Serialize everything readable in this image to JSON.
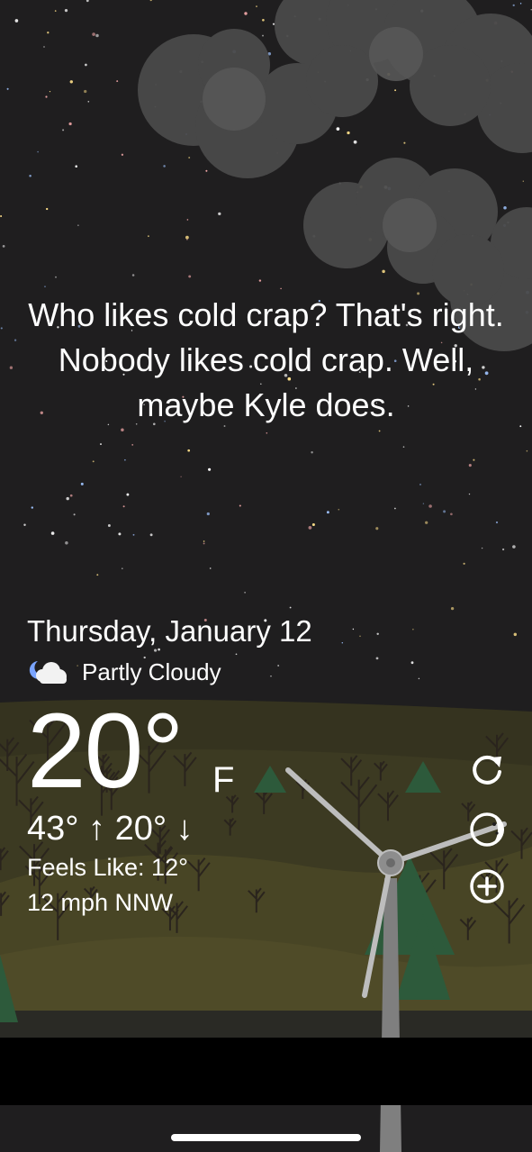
{
  "quote": "Who likes cold crap? That's right. Nobody likes cold crap. Well, maybe Kyle does.",
  "date": "Thursday, January 12",
  "condition": {
    "icon": "partly-cloudy-night-icon",
    "text": "Partly Cloudy"
  },
  "temperature": {
    "value": "20°",
    "unit": "F",
    "high_low": "43° ↑  20° ↓",
    "feels_like": "Feels Like: 12°",
    "wind": "12 mph NNW"
  },
  "actions": [
    {
      "name": "refresh-button",
      "icon": "refresh-icon"
    },
    {
      "name": "moon-phase-button",
      "icon": "moon-phase-icon"
    },
    {
      "name": "add-location-button",
      "icon": "add-circle-icon"
    }
  ],
  "colors": {
    "sky": "#1f1e1f",
    "cloud": "#4b4b4b",
    "ground": "#3a3720",
    "tree": "#2b5a3a",
    "text": "#ffffff"
  }
}
